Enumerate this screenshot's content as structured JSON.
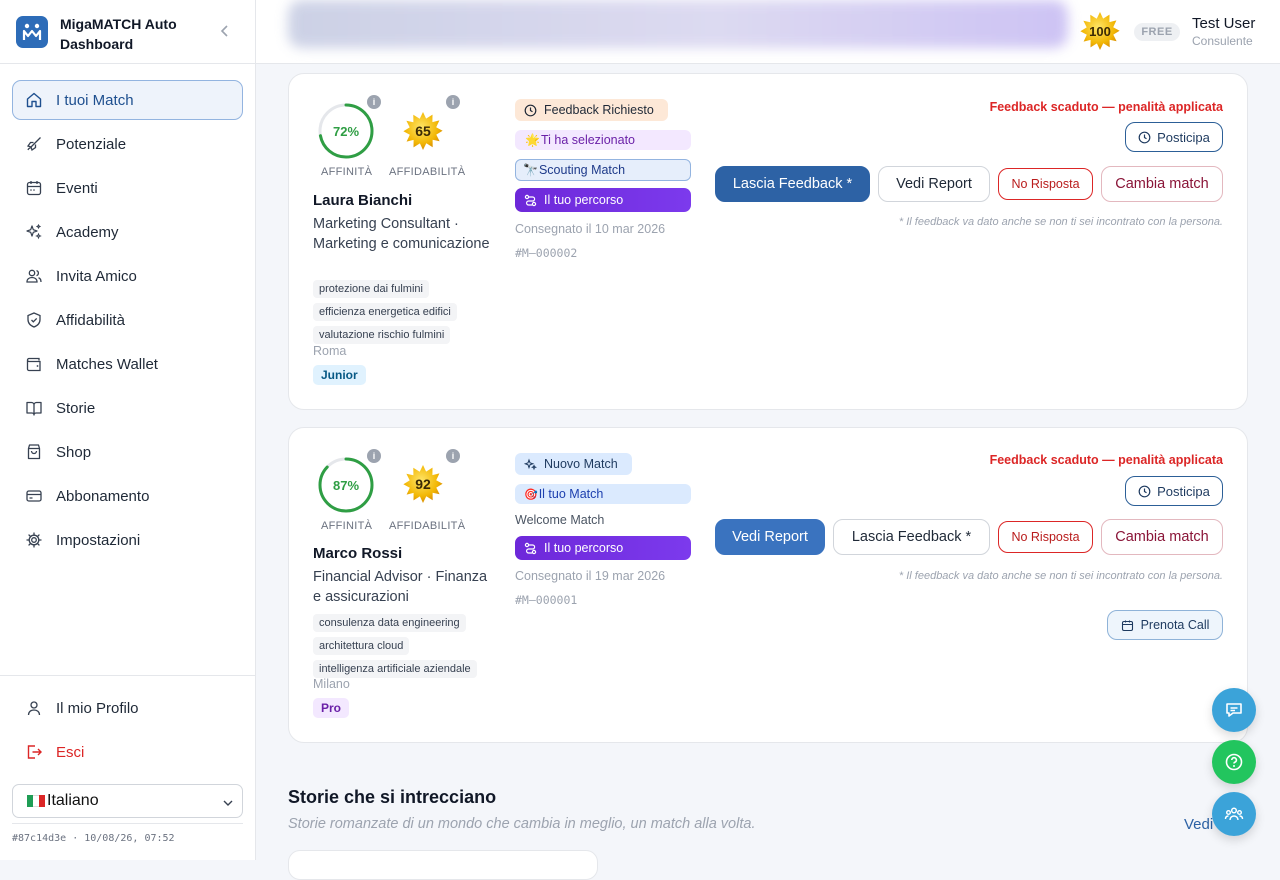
{
  "sidebar": {
    "app_name": "MigaMATCH Auto Dashboard",
    "items": [
      {
        "label": "I tuoi Match",
        "icon": "home-icon"
      },
      {
        "label": "Potenziale",
        "icon": "rocket-icon"
      },
      {
        "label": "Eventi",
        "icon": "calendar-icon"
      },
      {
        "label": "Academy",
        "icon": "sparkles-icon"
      },
      {
        "label": "Invita Amico",
        "icon": "users-icon"
      },
      {
        "label": "Affidabilità",
        "icon": "shield-icon"
      },
      {
        "label": "Matches Wallet",
        "icon": "wallet-icon"
      },
      {
        "label": "Storie",
        "icon": "book-icon"
      },
      {
        "label": "Shop",
        "icon": "bag-icon"
      },
      {
        "label": "Abbonamento",
        "icon": "credit-card-icon"
      },
      {
        "label": "Impostazioni",
        "icon": "gear-icon"
      }
    ],
    "profile_label": "Il mio Profilo",
    "logout_label": "Esci",
    "language": "Italiano",
    "build_info": "#87c14d3e · 10/08/26, 07:52"
  },
  "header": {
    "score": "100",
    "plan": "FREE",
    "user_name": "Test User",
    "user_role": "Consulente"
  },
  "matches": [
    {
      "affinity": "72%",
      "affinity_value": 72,
      "reliability": "65",
      "affinity_label": "AFFINITÀ",
      "reliability_label": "AFFIDABILITÀ",
      "name": "Laura Bianchi",
      "role": "Marketing Consultant · Marketing e comunicazione",
      "tags": [
        "protezione dai fulmini",
        "efficienza energetica edifici",
        "valutazione rischio fulmini"
      ],
      "city": "Roma",
      "level": "Junior",
      "badges": [
        "Feedback Richiesto",
        "Ti ha selezionato",
        "Scouting Match",
        "Il tuo percorso"
      ],
      "delivered": "Consegnato il 10 mar 2026",
      "code": "#M—000002",
      "warning": "Feedback scaduto — penalità applicata",
      "postpone": "Posticipa",
      "actions": [
        "Lascia Feedback *",
        "Vedi Report",
        "No Risposta",
        "Cambia match"
      ],
      "note": "* Il feedback va dato anche se non ti sei incontrato con la persona."
    },
    {
      "affinity": "87%",
      "affinity_value": 87,
      "reliability": "92",
      "affinity_label": "AFFINITÀ",
      "reliability_label": "AFFIDABILITÀ",
      "name": "Marco Rossi",
      "role": "Financial Advisor · Finanza e assicurazioni",
      "tags": [
        "consulenza data engineering",
        "architettura cloud",
        "intelligenza artificiale aziendale"
      ],
      "city": "Milano",
      "level": "Pro",
      "badges": [
        "Nuovo Match",
        "Il tuo Match",
        "Welcome Match",
        "Il tuo percorso"
      ],
      "delivered": "Consegnato il 19 mar 2026",
      "code": "#M—000001",
      "warning": "Feedback scaduto — penalità applicata",
      "postpone": "Posticipa",
      "actions": [
        "Vedi Report",
        "Lascia Feedback *",
        "No Risposta",
        "Cambia match"
      ],
      "note": "* Il feedback va dato anche se non ti sei incontrato con la persona.",
      "call": "Prenota Call"
    }
  ],
  "stories": {
    "title": "Storie che si intrecciano",
    "subtitle": "Storie romanzate di un mondo che cambia in meglio, un match alla volta.",
    "link": "Vedi"
  },
  "colors": {
    "primary": "#2d62a5",
    "danger": "#dc2626",
    "accent_purple": "#7c3aed",
    "success": "#2f9e44"
  }
}
